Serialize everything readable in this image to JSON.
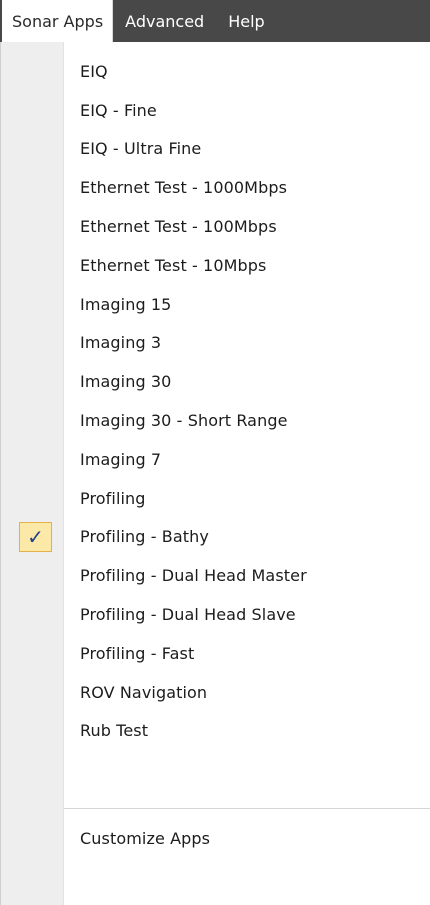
{
  "menubar": {
    "items": [
      {
        "label": "Sonar Apps"
      },
      {
        "label": "Advanced"
      },
      {
        "label": "Help"
      }
    ]
  },
  "menu": {
    "items": [
      {
        "label": "EIQ",
        "checked": false
      },
      {
        "label": "EIQ - Fine",
        "checked": false
      },
      {
        "label": "EIQ - Ultra Fine",
        "checked": false
      },
      {
        "label": "Ethernet Test - 1000Mbps",
        "checked": false
      },
      {
        "label": "Ethernet Test - 100Mbps",
        "checked": false
      },
      {
        "label": "Ethernet Test - 10Mbps",
        "checked": false
      },
      {
        "label": "Imaging 15",
        "checked": false
      },
      {
        "label": "Imaging 3",
        "checked": false
      },
      {
        "label": "Imaging 30",
        "checked": false
      },
      {
        "label": "Imaging 30 - Short Range",
        "checked": false
      },
      {
        "label": "Imaging 7",
        "checked": false
      },
      {
        "label": "Profiling",
        "checked": false
      },
      {
        "label": "Profiling - Bathy",
        "checked": true
      },
      {
        "label": "Profiling - Dual Head Master",
        "checked": false
      },
      {
        "label": "Profiling - Dual Head Slave",
        "checked": false
      },
      {
        "label": "Profiling - Fast",
        "checked": false
      },
      {
        "label": "ROV Navigation",
        "checked": false
      },
      {
        "label": "Rub Test",
        "checked": false
      }
    ],
    "check_glyph": "✓",
    "customize_label": "Customize Apps"
  },
  "colors": {
    "menubar_bg": "#484848",
    "gutter_bg": "#eeeeee",
    "check_bg": "#fde9a7",
    "check_border": "#e3b04a",
    "check_mark": "#1f3f8a"
  }
}
